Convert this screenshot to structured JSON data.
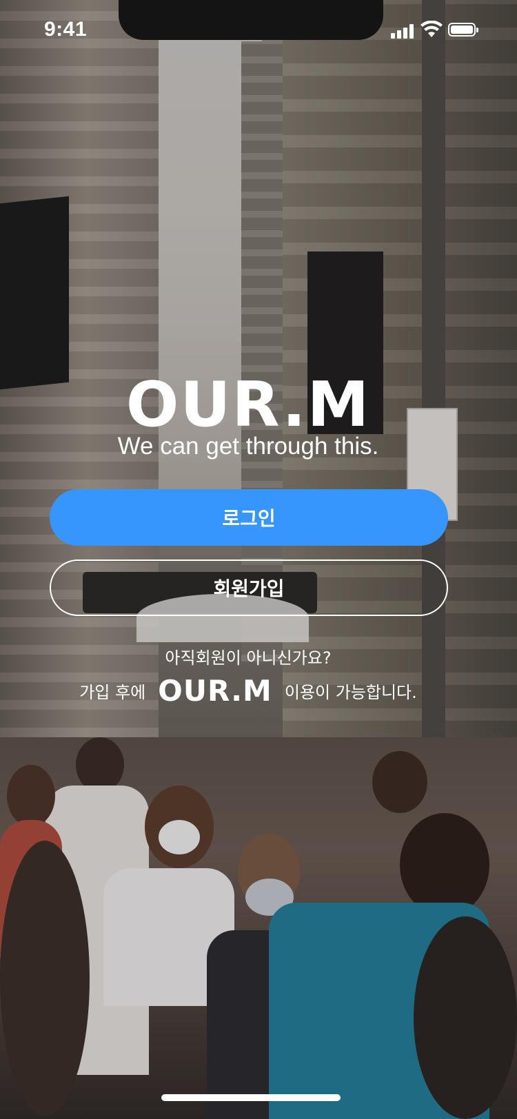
{
  "status_bar": {
    "time": "9:41"
  },
  "brand": {
    "logo": "OUR.M",
    "tagline": "We can get through this."
  },
  "buttons": {
    "login_label": "로그인",
    "signup_label": "회원가입"
  },
  "notice": {
    "line1": "아직회원이 아니신가요?",
    "line2_before": "가입 후에",
    "line2_brand": "OUR.M",
    "line2_after": "이용이 가능합니다."
  },
  "colors": {
    "accent": "#3796fb",
    "text": "#ffffff"
  }
}
